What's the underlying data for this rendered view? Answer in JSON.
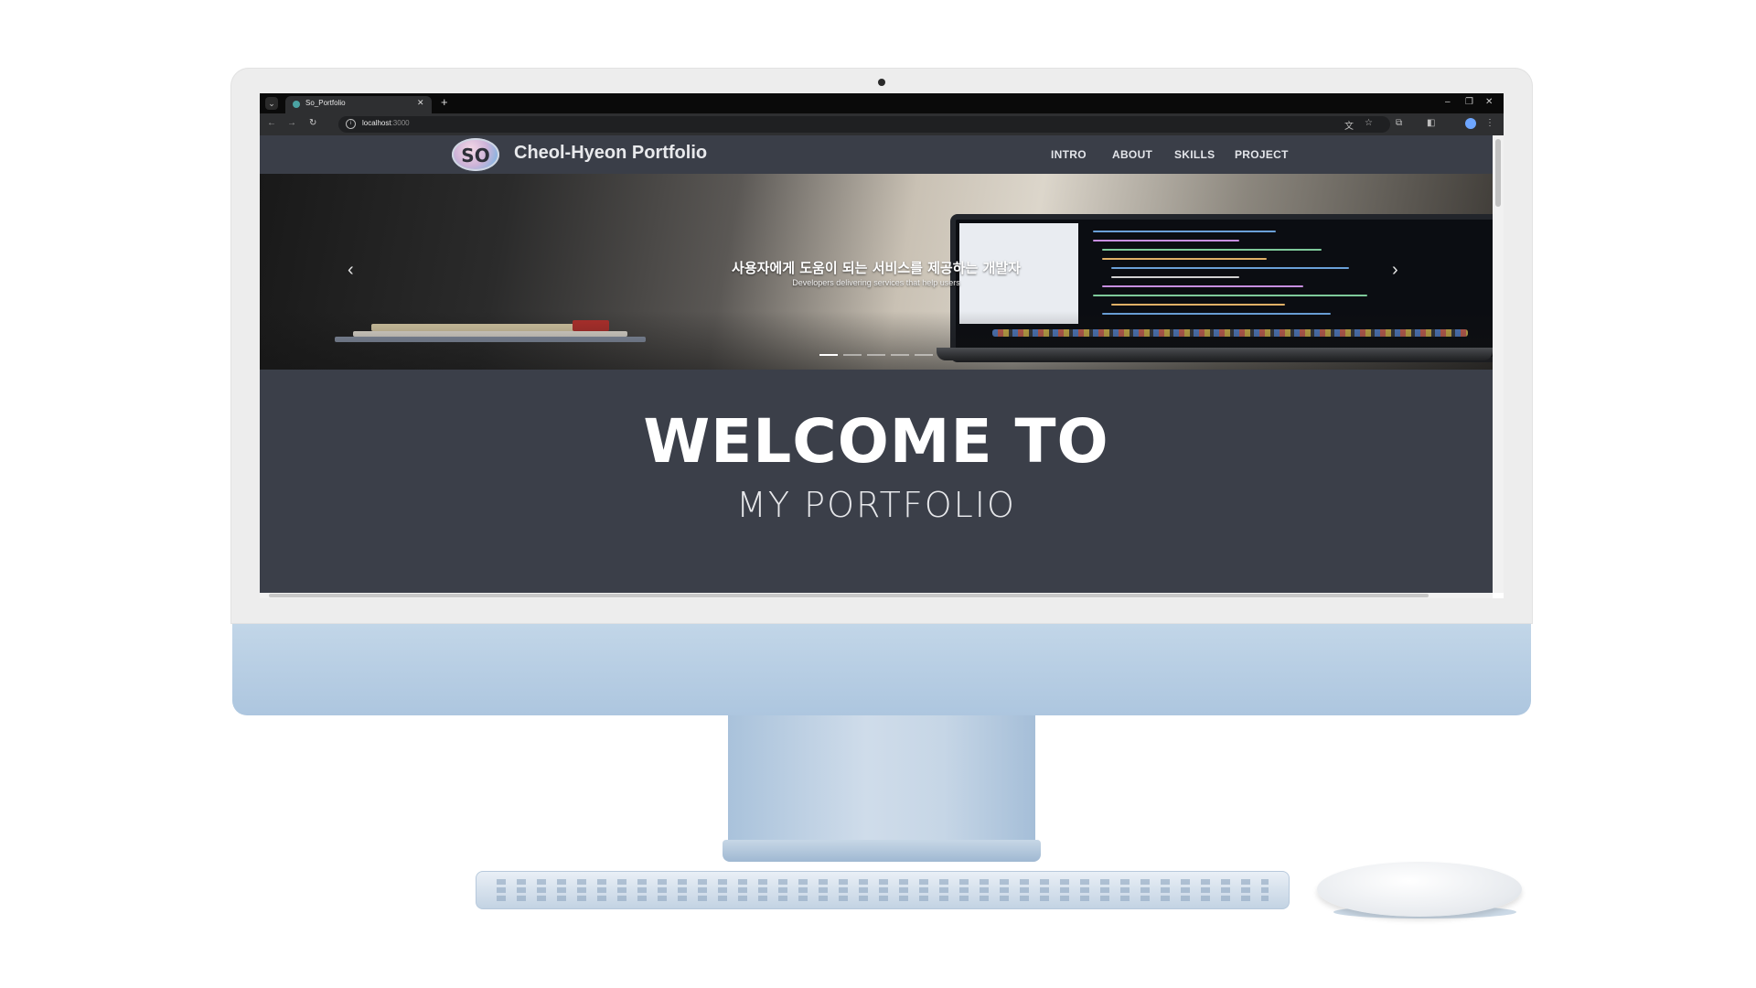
{
  "browser": {
    "tab_title": "So_Portfolio",
    "url_host": "localhost",
    "url_port": ":3000",
    "new_tab_glyph": "+",
    "close_glyph": "✕"
  },
  "site": {
    "logo_text": "SO",
    "brand": "Cheol-Hyeon Portfolio",
    "nav": [
      "INTRO",
      "ABOUT",
      "SKILLS",
      "PROJECT"
    ]
  },
  "hero": {
    "title": "사용자에게 도움이 되는 서비스를 제공하는 개발자",
    "subtitle": "Developers delivering services that help users",
    "slide_count": 5,
    "active_slide": 1
  },
  "welcome": {
    "line1": "WELCOME TO",
    "line2": "MY PORTFOLIO"
  },
  "icons": {
    "prev": "chevron-left-icon",
    "next": "chevron-right-icon",
    "info": "info-icon",
    "translate": "translate-icon",
    "bookmark": "star-icon",
    "extensions": "puzzle-icon",
    "sidepanel": "side-panel-icon",
    "profile": "profile-icon",
    "menu": "more-vert-icon"
  }
}
